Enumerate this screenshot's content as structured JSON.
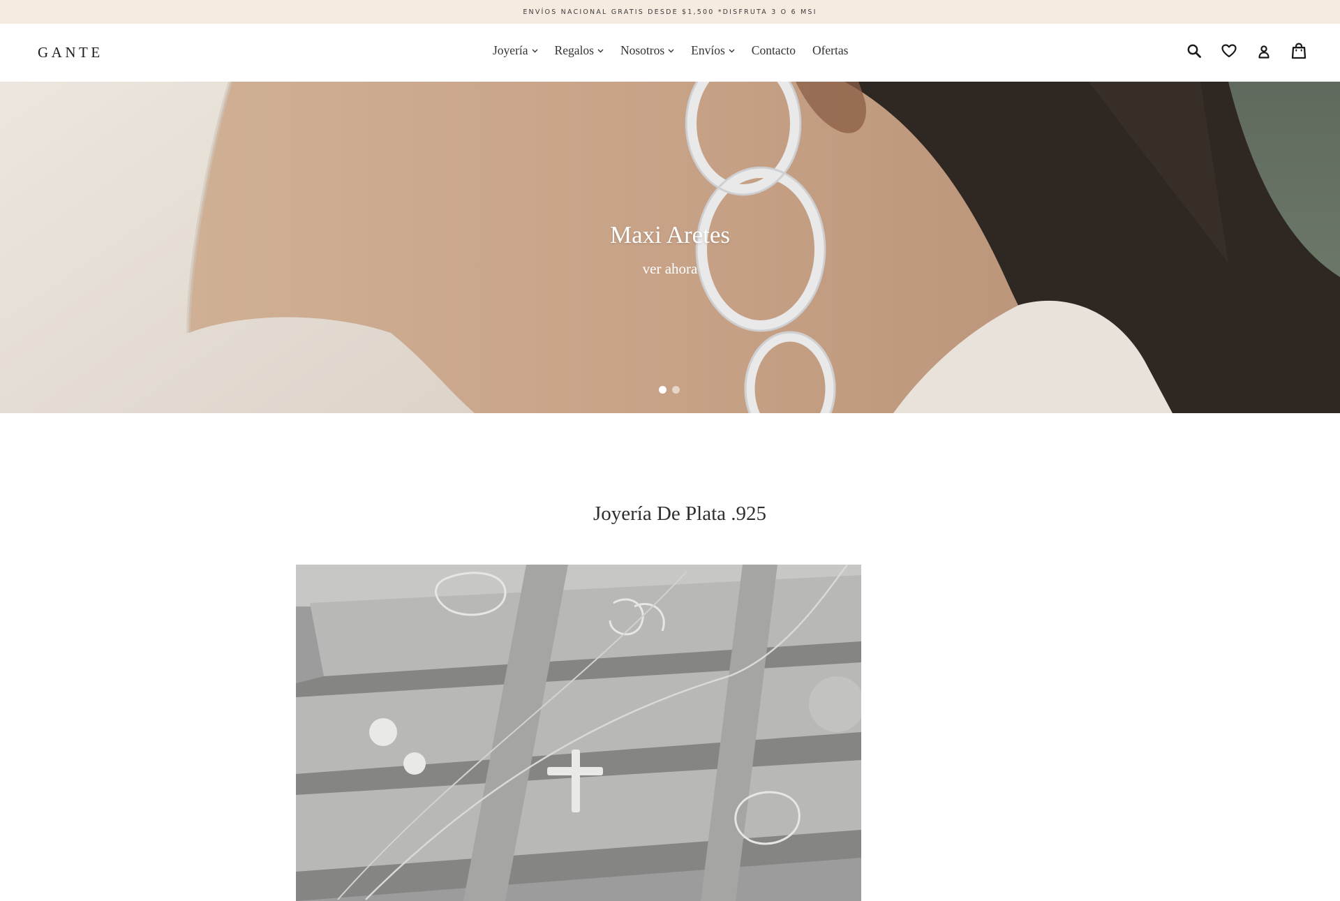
{
  "announcement": {
    "text": "ENVÍOS NACIONAL GRATIS DESDE $1,500 *DISFRUTA 3 O 6 MSI"
  },
  "header": {
    "logo": "GANTE",
    "nav": [
      {
        "label": "Joyería",
        "has_dropdown": true
      },
      {
        "label": "Regalos",
        "has_dropdown": true
      },
      {
        "label": "Nosotros",
        "has_dropdown": true
      },
      {
        "label": "Envíos",
        "has_dropdown": true
      },
      {
        "label": "Contacto",
        "has_dropdown": false
      },
      {
        "label": "Ofertas",
        "has_dropdown": false
      }
    ],
    "icons": [
      "search-icon",
      "heart-icon",
      "user-icon",
      "bag-icon"
    ]
  },
  "hero": {
    "title": "Maxi Aretes",
    "link": "ver ahora",
    "slides": 2,
    "active_slide": 1
  },
  "section": {
    "title": "Joyería De Plata .925"
  },
  "colors": {
    "announcement_bg": "#f5ebe0",
    "text": "#333333",
    "hero_text": "#ffffff"
  }
}
